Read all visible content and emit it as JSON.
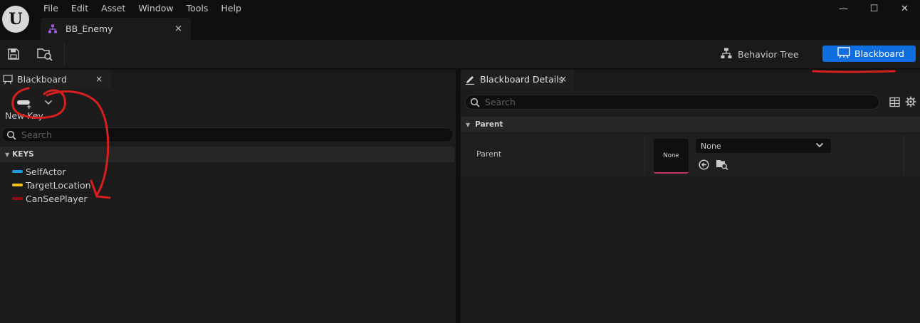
{
  "menu": [
    "File",
    "Edit",
    "Asset",
    "Window",
    "Tools",
    "Help"
  ],
  "window_controls": {
    "minimize": "—",
    "maximize": "☐",
    "close": "✕"
  },
  "document_tab": {
    "label": "BB_Enemy",
    "close": "×"
  },
  "toolbar": {
    "modes": [
      {
        "label": "Behavior Tree",
        "icon": "behavior-tree-icon",
        "active": false
      },
      {
        "label": "Blackboard",
        "icon": "blackboard-icon",
        "active": true
      }
    ],
    "active_color": "#0e6ee0"
  },
  "blackboard_panel": {
    "tab_label": "Blackboard",
    "tab_close": "×",
    "new_key_label": "New Key",
    "search_placeholder": "Search",
    "section_label": "KEYS",
    "keys": [
      {
        "name": "SelfActor",
        "color": "#1e9be8"
      },
      {
        "name": "TargetLocation",
        "color": "#f2c21a"
      },
      {
        "name": "CanSeePlayer",
        "color": "#8f0d0d"
      }
    ]
  },
  "details_panel": {
    "tab_label": "Blackboard Details",
    "tab_close": "×",
    "search_placeholder": "Search",
    "section_label": "Parent",
    "parent_row": {
      "label": "Parent",
      "thumbnail_text": "None",
      "dropdown_value": "None"
    }
  },
  "annotation_color": "#d61f1f"
}
